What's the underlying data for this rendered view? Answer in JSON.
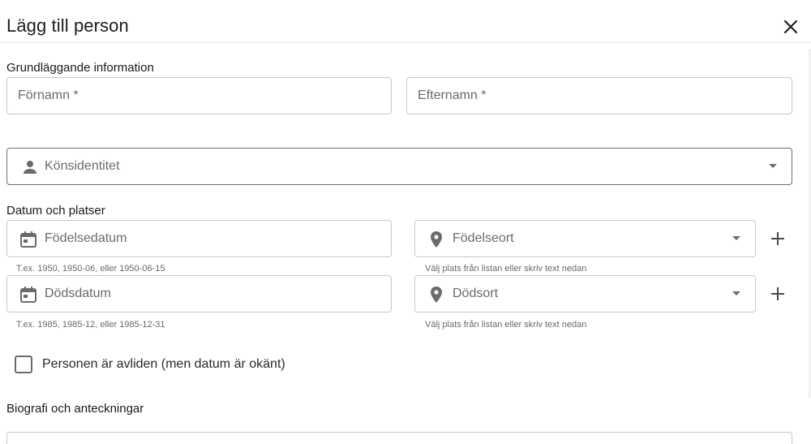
{
  "dialog": {
    "title": "Lägg till person"
  },
  "basic": {
    "section_title": "Grundläggande information",
    "first_name_label": "Förnamn *",
    "last_name_label": "Efternamn *",
    "gender_label": "Könsidentitet"
  },
  "dates": {
    "section_title": "Datum och platser",
    "birth_date_label": "Födelsedatum",
    "birth_date_helper": "T.ex. 1950, 1950-06, eller 1950-06-15",
    "birth_place_label": "Födelseort",
    "birth_place_helper": "Välj plats från listan eller skriv text nedan",
    "death_date_label": "Dödsdatum",
    "death_date_helper": "T.ex. 1985, 1985-12, eller 1985-12-31",
    "death_place_label": "Dödsort",
    "death_place_helper": "Välj plats från listan eller skriv text nedan",
    "deceased_checkbox_label": "Personen är avliden (men datum är okänt)",
    "deceased_checked": false
  },
  "bio": {
    "section_title": "Biografi och anteckningar"
  },
  "icons": {
    "close": "close-icon",
    "person": "person-icon",
    "calendar": "calendar-icon",
    "location": "location-pin-icon",
    "dropdown": "chevron-down-icon",
    "add": "plus-icon"
  },
  "colors": {
    "icon": "#6b6b6b",
    "border": "#c7c7c7",
    "text": "#1f1f1f"
  }
}
